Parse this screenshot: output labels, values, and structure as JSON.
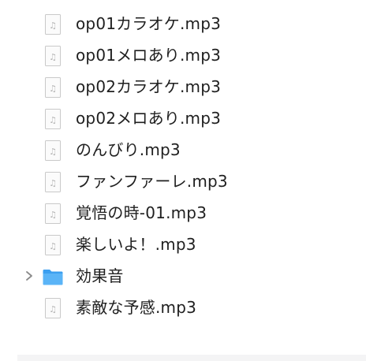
{
  "files": [
    {
      "name": "op01カラオケ.mp3",
      "kind": "audio",
      "icon": "audio-file-icon"
    },
    {
      "name": "op01メロあり.mp3",
      "kind": "audio",
      "icon": "audio-file-icon"
    },
    {
      "name": "op02カラオケ.mp3",
      "kind": "audio",
      "icon": "audio-file-icon"
    },
    {
      "name": "op02メロあり.mp3",
      "kind": "audio",
      "icon": "audio-file-icon"
    },
    {
      "name": "のんびり.mp3",
      "kind": "audio",
      "icon": "audio-file-icon"
    },
    {
      "name": "ファンファーレ.mp3",
      "kind": "audio",
      "icon": "audio-file-icon"
    },
    {
      "name": "覚悟の時-01.mp3",
      "kind": "audio",
      "icon": "audio-file-icon"
    },
    {
      "name": "楽しいよ！.mp3",
      "kind": "audio",
      "icon": "audio-file-icon"
    },
    {
      "name": "効果音",
      "kind": "folder",
      "icon": "folder-icon",
      "disclosure": "chevron-right-icon"
    },
    {
      "name": "素敵な予感.mp3",
      "kind": "audio",
      "icon": "audio-file-icon"
    }
  ],
  "colors": {
    "stripe": "#f4f4f5",
    "folder": "#3b9ff0",
    "text": "#1f1f1f"
  }
}
